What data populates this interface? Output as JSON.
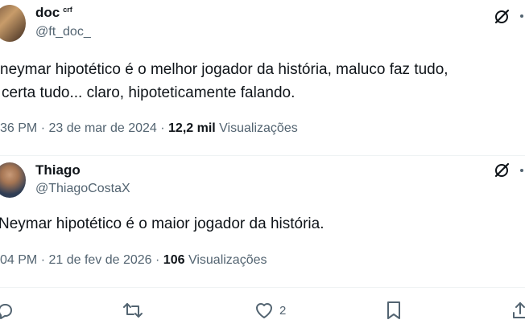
{
  "tweet1": {
    "name": "doc",
    "badge": "crf",
    "handle": "@ft_doc_",
    "line1": "neymar hipotético é o melhor jogador da história, maluco faz tudo,",
    "line2": "certa tudo... claro, hipoteticamente falando.",
    "time_date": "36 PM · 23 de mar de 2024 ·",
    "views_count": "12,2 mil",
    "views_label": "Visualizações"
  },
  "tweet2": {
    "name": "Thiago",
    "handle": "@ThiagoCostaX",
    "line1": "Neymar hipotético é o maior jogador da história.",
    "time_date": "04 PM · 21 de fev de 2026 ·",
    "views_count": "106",
    "views_label": "Visualizações"
  },
  "actions": {
    "like_count": "2"
  },
  "colors": {
    "text": "#0f1419",
    "secondary": "#536471",
    "divider": "#eff3f4"
  },
  "icons": [
    "grok-icon",
    "more-icon",
    "reply-icon",
    "retweet-icon",
    "heart-icon",
    "bookmark-icon",
    "share-icon"
  ]
}
